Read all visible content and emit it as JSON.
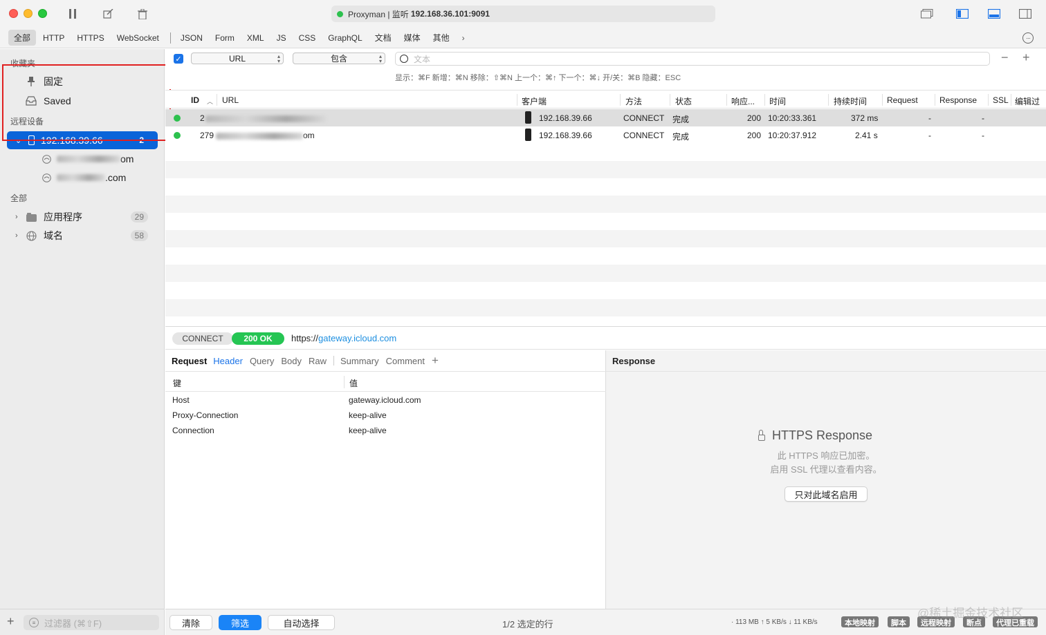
{
  "window": {
    "app_name": "Proxyman | 监听",
    "address": "192.168.36.101:9091"
  },
  "filter_tabs": [
    "全部",
    "HTTP",
    "HTTPS",
    "WebSocket",
    "JSON",
    "Form",
    "XML",
    "JS",
    "CSS",
    "GraphQL",
    "文档",
    "媒体",
    "其他"
  ],
  "sidebar": {
    "favorites_title": "收藏夹",
    "pinned_label": "固定",
    "saved_label": "Saved",
    "remote_title": "远程设备",
    "device_label": "192.168.39.66",
    "device_count": "2",
    "domain_1_suffix": "om",
    "domain_2_suffix": ".com",
    "all_title": "全部",
    "apps_label": "应用程序",
    "apps_count": "29",
    "domains_label": "域名",
    "domains_count": "58",
    "filter_placeholder": "过滤器 (⌘⇧F)"
  },
  "filter_row": {
    "field_select": "URL",
    "op_select": "包含",
    "search_placeholder": "文本",
    "hint": "显示：⌘F  新增：⌘N  移除：⇧⌘N  上一个：⌘↑  下一个：⌘↓  开/关：⌘B  隐藏：ESC"
  },
  "table": {
    "columns": [
      "ID",
      "URL",
      "客户端",
      "方法",
      "状态",
      "响应...",
      "时间",
      "持续时间",
      "Request",
      "Response",
      "SSL",
      "编辑过"
    ],
    "rows": [
      {
        "id": "2",
        "url": "",
        "client": "192.168.39.66",
        "method": "CONNECT",
        "status": "完成",
        "code": "200",
        "time": "10:20:33.361",
        "duration": "372 ms",
        "request": "-",
        "response": "-"
      },
      {
        "id": "279",
        "url": "om",
        "client": "192.168.39.66",
        "method": "CONNECT",
        "status": "完成",
        "code": "200",
        "time": "10:20:37.912",
        "duration": "2.41 s",
        "request": "-",
        "response": "-"
      }
    ]
  },
  "detail": {
    "method": "CONNECT",
    "status": "200 OK",
    "url_scheme": "https://",
    "url_host": "gateway.icloud.com"
  },
  "request_panel": {
    "title": "Request",
    "tabs": [
      "Header",
      "Query",
      "Body",
      "Raw",
      "Summary",
      "Comment"
    ],
    "key_header": "键",
    "value_header": "值",
    "headers": [
      {
        "key": "Host",
        "value": "gateway.icloud.com"
      },
      {
        "key": "Proxy-Connection",
        "value": "keep-alive"
      },
      {
        "key": "Connection",
        "value": "keep-alive"
      }
    ]
  },
  "response_panel": {
    "title": "Response",
    "https_title": "HTTPS Response",
    "line1": "此 HTTPS 响应已加密。",
    "line2": "启用 SSL 代理以查看内容。",
    "enable_button": "只对此域名启用"
  },
  "bottom": {
    "clear_button": "清除",
    "filter_button": "筛选",
    "auto_select_button": "自动选择",
    "selection_text": "1/2 选定的行",
    "net_stats": "· 113 MB ↑ 5 KB/s ↓ 11 KB/s",
    "tags": [
      "本地映射",
      "脚本",
      "远程映射",
      "断点",
      "代理已重载"
    ],
    "watermark": "@稀土掘金技术社区"
  },
  "colors": {
    "accent": "#1a73e8",
    "selected_sidebar": "#0a64d9",
    "status_green": "#25c553",
    "highlight_box": "#e02020"
  }
}
